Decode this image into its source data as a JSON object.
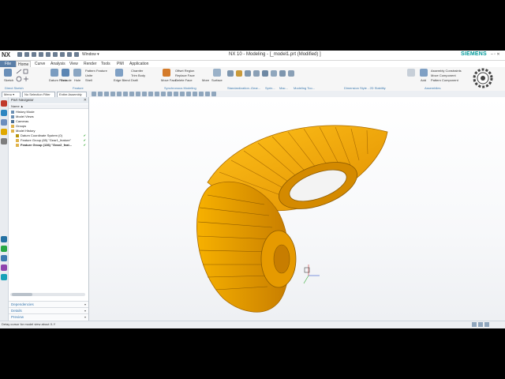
{
  "app": {
    "logo": "NX",
    "title": "NX 10 - Modeling - [_model1.prt (Modified) ]",
    "window_menu": "Window ▾",
    "brand": "SIEMENS",
    "window_controls": "– ▫ ✕"
  },
  "tabs": [
    "File",
    "Home",
    "Curve",
    "Analysis",
    "View",
    "Render",
    "Tools",
    "PMI",
    "Application"
  ],
  "ribbon": {
    "groups": [
      {
        "label": "Direct Sketch",
        "items": [
          "Sketch"
        ]
      },
      {
        "label": "Feature",
        "items": [
          "Datum Plane",
          "Extrude",
          "Hole",
          "Pattern Feature",
          "Unite",
          "Shell"
        ]
      },
      {
        "label": "Edge Blend",
        "items": [
          "Edge Blend",
          "Chamfer",
          "Trim Body",
          "Draft"
        ]
      },
      {
        "label": "Synchronous Modeling",
        "items": [
          "More",
          "Move Face",
          "Offset Region",
          "Replace Face",
          "Delete Face"
        ]
      },
      {
        "label": "Standard",
        "items": [
          "More",
          "Surface"
        ]
      },
      {
        "label": "Standardization...",
        "items": []
      },
      {
        "label": "Gear...",
        "items": []
      },
      {
        "label": "Sprin...",
        "items": []
      },
      {
        "label": "Mac...",
        "items": []
      },
      {
        "label": "Modeling Too...",
        "items": []
      },
      {
        "label": "Dimension Style - 2D Stability",
        "items": []
      },
      {
        "label": "Assemblies",
        "items": [
          "Assembly Constraints",
          "Move Component",
          "Pattern Component",
          "Add"
        ]
      }
    ]
  },
  "selection_bar": {
    "menu": "Menu ▾",
    "filter": "No Selection Filter",
    "scope": "Entire Assembly"
  },
  "navigator": {
    "title": "Part Navigator",
    "column": "Name ▲",
    "items": [
      {
        "label": "History Mode",
        "checked": false
      },
      {
        "label": "Model Views",
        "checked": false
      },
      {
        "label": "Cameras",
        "checked": false
      },
      {
        "label": "Groups",
        "checked": false
      },
      {
        "label": "Model History",
        "checked": false
      },
      {
        "label": "Datum Coordinate System (0)",
        "checked": true
      },
      {
        "label": "Feature Group (65) \"Gear1_feature\"",
        "checked": true
      },
      {
        "label": "Feature Group (136) \"Gear2_feat...",
        "checked": true
      }
    ],
    "panels": [
      "Dependencies",
      "Details",
      "Preview"
    ]
  },
  "status": {
    "text": "Delay cursor for model view about X-Y"
  },
  "colors": {
    "gear": "#f5a800",
    "gear_dark": "#a86a00",
    "accent": "#3c7ab0"
  }
}
